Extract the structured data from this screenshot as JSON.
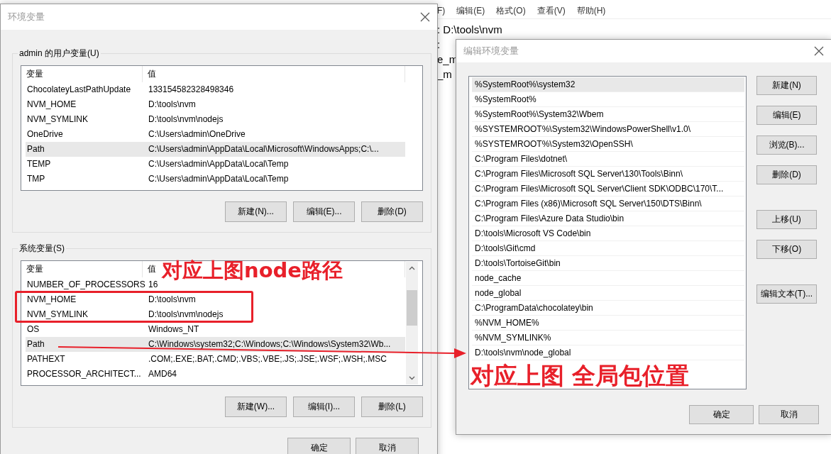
{
  "notepad": {
    "menu": [
      "F)",
      "编辑(E)",
      "格式(O)",
      "查看(V)",
      "帮助(H)"
    ],
    "lines": [
      ": D:\\tools\\nvm",
      ":",
      "e_m",
      "_m"
    ]
  },
  "env_dialog": {
    "title": "环境变量",
    "user_vars": {
      "label": "admin 的用户变量(U)",
      "columns": [
        "变量",
        "值"
      ],
      "rows": [
        {
          "name": "ChocolateyLastPathUpdate",
          "value": "133154582328498346",
          "selected": false
        },
        {
          "name": "NVM_HOME",
          "value": "D:\\tools\\nvm",
          "selected": false
        },
        {
          "name": "NVM_SYMLINK",
          "value": "D:\\tools\\nvm\\nodejs",
          "selected": false
        },
        {
          "name": "OneDrive",
          "value": "C:\\Users\\admin\\OneDrive",
          "selected": false
        },
        {
          "name": "Path",
          "value": "C:\\Users\\admin\\AppData\\Local\\Microsoft\\WindowsApps;C:\\...",
          "selected": true
        },
        {
          "name": "TEMP",
          "value": "C:\\Users\\admin\\AppData\\Local\\Temp",
          "selected": false
        },
        {
          "name": "TMP",
          "value": "C:\\Users\\admin\\AppData\\Local\\Temp",
          "selected": false
        }
      ],
      "buttons": [
        "新建(N)...",
        "编辑(E)...",
        "删除(D)"
      ]
    },
    "system_vars": {
      "label": "系统变量(S)",
      "columns": [
        "变量",
        "值"
      ],
      "rows": [
        {
          "name": "NUMBER_OF_PROCESSORS",
          "value": "16",
          "selected": false
        },
        {
          "name": "NVM_HOME",
          "value": "D:\\tools\\nvm",
          "selected": false
        },
        {
          "name": "NVM_SYMLINK",
          "value": "D:\\tools\\nvm\\nodejs",
          "selected": false
        },
        {
          "name": "OS",
          "value": "Windows_NT",
          "selected": false
        },
        {
          "name": "Path",
          "value": "C:\\Windows\\system32;C:\\Windows;C:\\Windows\\System32\\Wb...",
          "selected": true
        },
        {
          "name": "PATHEXT",
          "value": ".COM;.EXE;.BAT;.CMD;.VBS;.VBE;.JS;.JSE;.WSF;.WSH;.MSC",
          "selected": false
        },
        {
          "name": "PROCESSOR_ARCHITECT...",
          "value": "AMD64",
          "selected": false
        }
      ],
      "buttons": [
        "新建(W)...",
        "编辑(I)...",
        "删除(L)"
      ]
    },
    "buttons": [
      "确定",
      "取消"
    ]
  },
  "edit_dialog": {
    "title": "编辑环境变量",
    "items": [
      {
        "text": "%SystemRoot%\\system32",
        "selected": true
      },
      {
        "text": "%SystemRoot%",
        "selected": false
      },
      {
        "text": "%SystemRoot%\\System32\\Wbem",
        "selected": false
      },
      {
        "text": "%SYSTEMROOT%\\System32\\WindowsPowerShell\\v1.0\\",
        "selected": false
      },
      {
        "text": "%SYSTEMROOT%\\System32\\OpenSSH\\",
        "selected": false
      },
      {
        "text": "C:\\Program Files\\dotnet\\",
        "selected": false
      },
      {
        "text": "C:\\Program Files\\Microsoft SQL Server\\130\\Tools\\Binn\\",
        "selected": false
      },
      {
        "text": "C:\\Program Files\\Microsoft SQL Server\\Client SDK\\ODBC\\170\\T...",
        "selected": false
      },
      {
        "text": "C:\\Program Files (x86)\\Microsoft SQL Server\\150\\DTS\\Binn\\",
        "selected": false
      },
      {
        "text": "C:\\Program Files\\Azure Data Studio\\bin",
        "selected": false
      },
      {
        "text": "D:\\tools\\Microsoft VS Code\\bin",
        "selected": false
      },
      {
        "text": "D:\\tools\\Git\\cmd",
        "selected": false
      },
      {
        "text": "D:\\tools\\TortoiseGit\\bin",
        "selected": false
      },
      {
        "text": "node_cache",
        "selected": false
      },
      {
        "text": "node_global",
        "selected": false
      },
      {
        "text": "C:\\ProgramData\\chocolatey\\bin",
        "selected": false
      },
      {
        "text": "%NVM_HOME%",
        "selected": false
      },
      {
        "text": "%NVM_SYMLINK%",
        "selected": false
      },
      {
        "text": "D:\\tools\\nvm\\node_global",
        "selected": false
      }
    ],
    "side_buttons": [
      [
        "新建(N)",
        "编辑(E)",
        "浏览(B)...",
        "删除(D)"
      ],
      [
        "上移(U)",
        "下移(O)"
      ],
      [
        "编辑文本(T)..."
      ]
    ],
    "buttons": [
      "确定",
      "取消"
    ]
  },
  "annotations": [
    "对应上图node路径",
    "对应上图 全局包位置"
  ]
}
